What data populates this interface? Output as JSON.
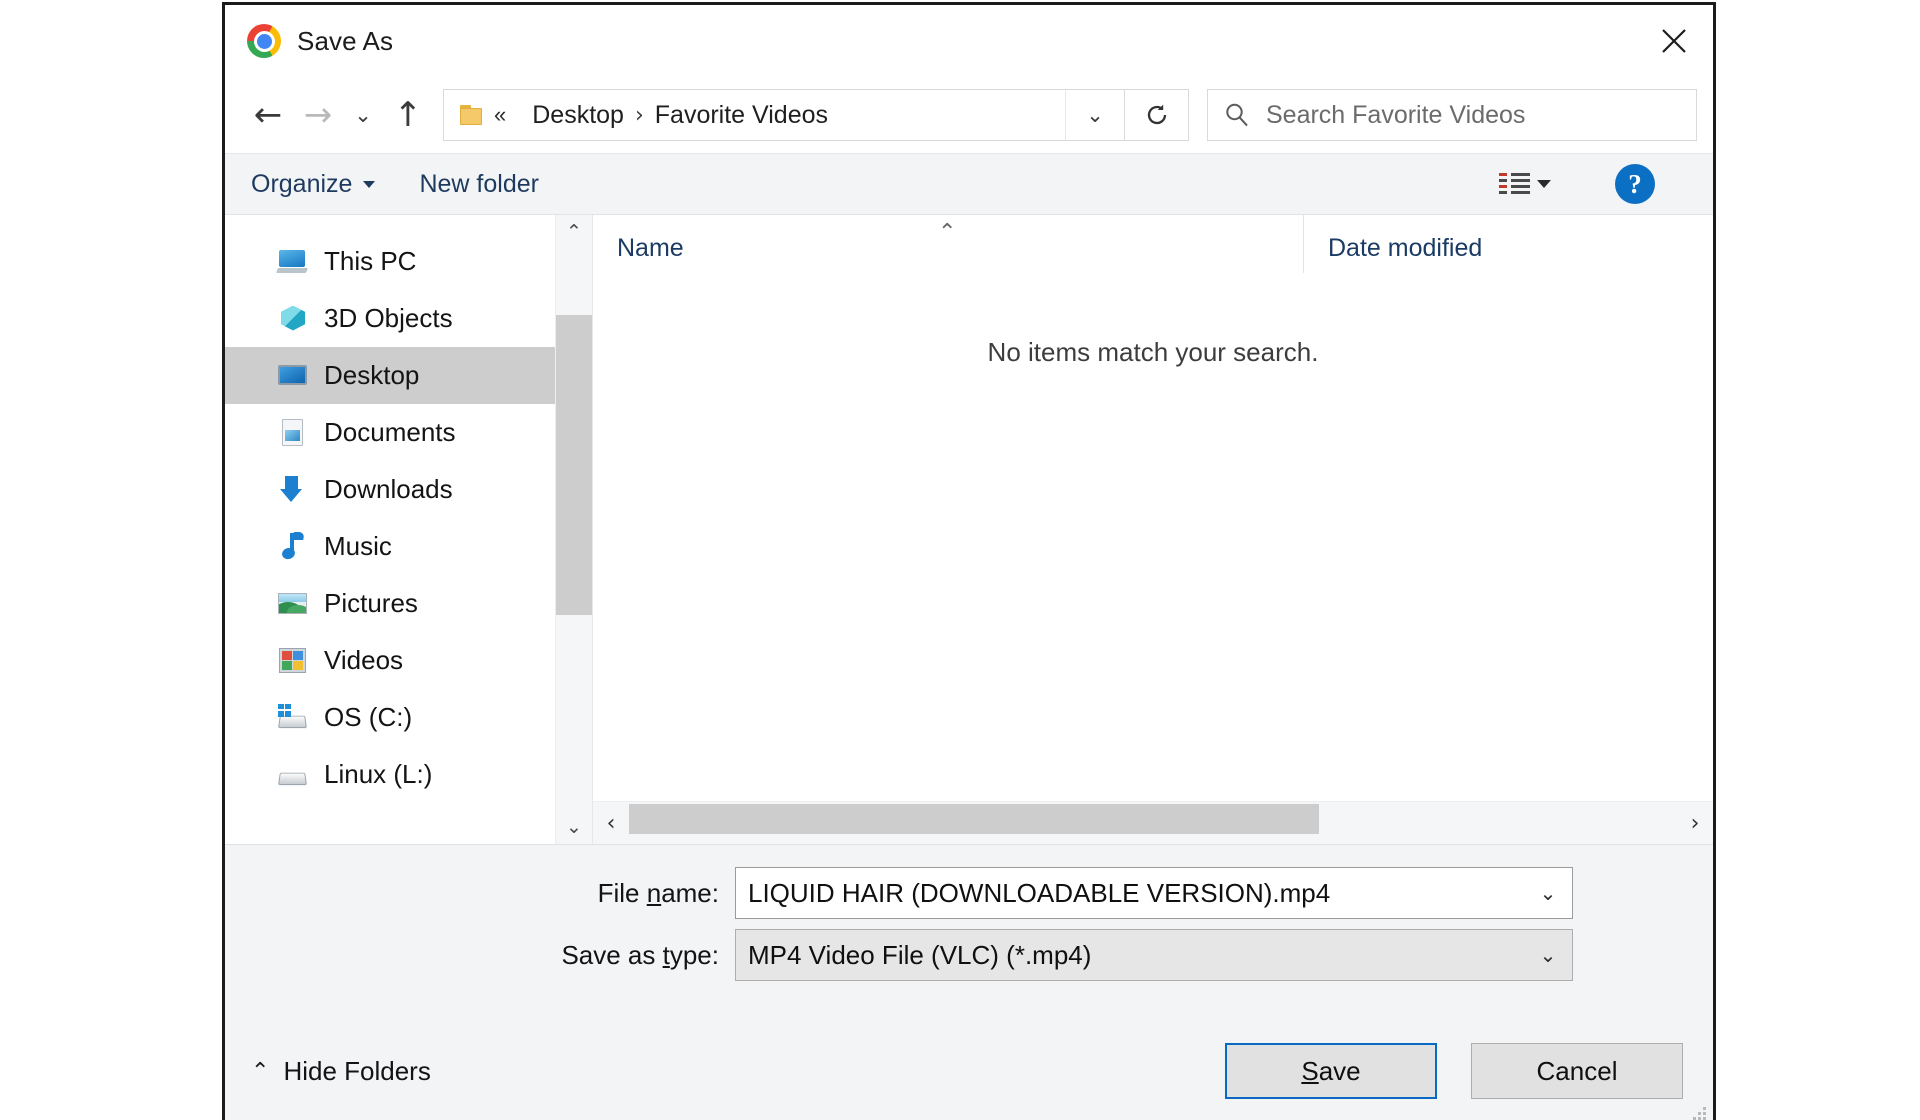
{
  "window": {
    "title": "Save As",
    "app_icon": "chrome-icon",
    "close_label": "✕"
  },
  "navigation": {
    "back_icon": "back-arrow-icon",
    "forward_icon": "forward-arrow-icon",
    "recent_icon": "chevron-down-icon",
    "up_icon": "up-arrow-icon",
    "folder_icon": "folder-icon",
    "breadcrumb_overflow": "«",
    "breadcrumbs": [
      "Desktop",
      "Favorite Videos"
    ],
    "separator": "›",
    "address_dropdown_icon": "chevron-down-icon",
    "refresh_icon": "refresh-icon"
  },
  "search": {
    "icon": "search-icon",
    "placeholder": "Search Favorite Videos",
    "value": ""
  },
  "toolbar": {
    "organize_label": "Organize",
    "new_folder_label": "New folder",
    "view_icon": "view-options-icon",
    "view_dropdown_icon": "chevron-down-icon",
    "help_label": "?"
  },
  "sidebar": {
    "scroll_up_icon": "chevron-up-icon",
    "scroll_down_icon": "chevron-down-icon",
    "items": [
      {
        "label": "This PC",
        "icon": "this-pc-icon",
        "selected": false
      },
      {
        "label": "3D Objects",
        "icon": "3d-objects-icon",
        "selected": false
      },
      {
        "label": "Desktop",
        "icon": "desktop-icon",
        "selected": true
      },
      {
        "label": "Documents",
        "icon": "documents-icon",
        "selected": false
      },
      {
        "label": "Downloads",
        "icon": "downloads-icon",
        "selected": false
      },
      {
        "label": "Music",
        "icon": "music-icon",
        "selected": false
      },
      {
        "label": "Pictures",
        "icon": "pictures-icon",
        "selected": false
      },
      {
        "label": "Videos",
        "icon": "videos-icon",
        "selected": false
      },
      {
        "label": "OS (C:)",
        "icon": "drive-os-icon",
        "selected": false
      },
      {
        "label": "Linux (L:)",
        "icon": "drive-linux-icon",
        "selected": false
      }
    ]
  },
  "file_list": {
    "columns": [
      "Name",
      "Date modified"
    ],
    "sort_column": "Name",
    "sort_caret": "⌃",
    "rows": [],
    "empty_message": "No items match your search.",
    "hscroll_left_icon": "chevron-left-icon",
    "hscroll_right_icon": "chevron-right-icon"
  },
  "form": {
    "file_name_label_pre": "File ",
    "file_name_label_accel": "n",
    "file_name_label_post": "ame:",
    "file_name_value": "LIQUID HAIR (DOWNLOADABLE VERSION).mp4",
    "file_name_placeholder": "",
    "save_type_label_pre": "Save as ",
    "save_type_label_accel": "t",
    "save_type_label_post": "ype:",
    "save_type_value": "MP4 Video File (VLC) (*.mp4)",
    "dropdown_icon": "chevron-down-icon"
  },
  "footer": {
    "hide_folders_caret": "⌃",
    "hide_folders_label": "Hide Folders",
    "save_label_pre": "",
    "save_label_accel": "S",
    "save_label_post": "ave",
    "cancel_label": "Cancel"
  },
  "colors": {
    "accent": "#0a69c2",
    "selection": "#cdcdcd",
    "chrome_bg": "#f3f4f6",
    "link_text": "#1e3a5f"
  }
}
